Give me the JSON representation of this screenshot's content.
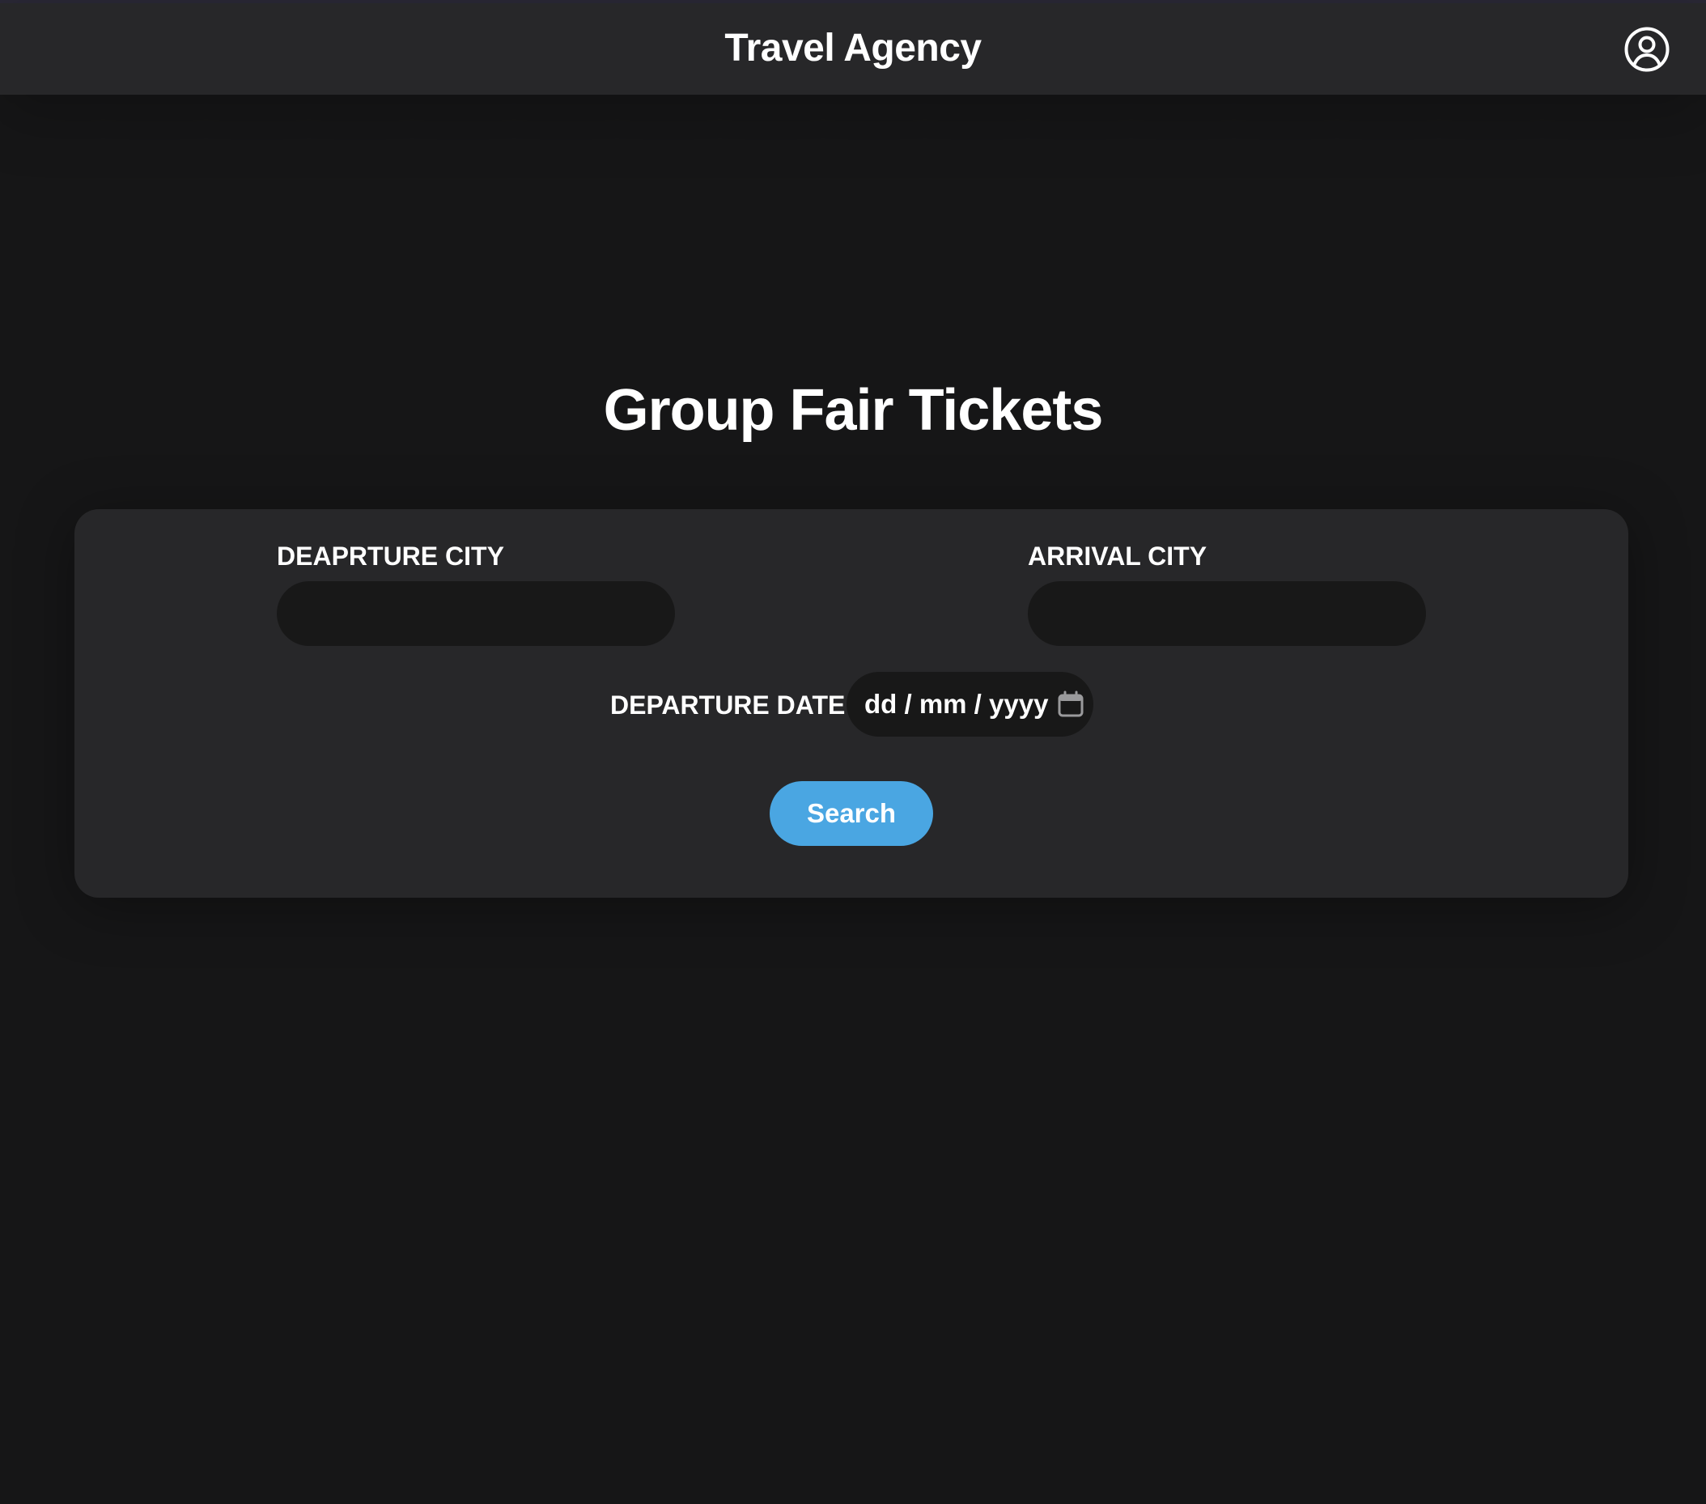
{
  "header": {
    "title": "Travel Agency",
    "account_icon": "user-circle-icon"
  },
  "main": {
    "title": "Group Fair Tickets"
  },
  "search_form": {
    "departure_city_label": "DEAPRTURE CITY",
    "departure_city_value": "",
    "arrival_city_label": "ARRIVAL CITY",
    "arrival_city_value": "",
    "departure_date_label": "DEPARTURE DATE",
    "departure_date_placeholder": "dd / mm / yyyy",
    "calendar_icon": "calendar-icon",
    "search_label": "Search"
  },
  "colors": {
    "background": "#161617",
    "header_background": "#272729",
    "card_background": "#272729",
    "input_background": "#181818",
    "accent": "#4aa6e2",
    "text": "#ffffff"
  }
}
